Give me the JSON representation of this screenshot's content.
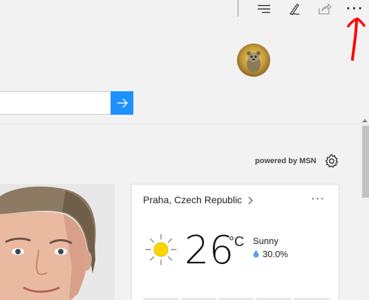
{
  "toolbar": {
    "items": [
      {
        "icon": "reading-list-icon"
      },
      {
        "icon": "pen-annotate-icon"
      },
      {
        "icon": "share-icon"
      },
      {
        "icon": "more-icon",
        "label": "···"
      }
    ]
  },
  "profile": {
    "avatar": "avatar"
  },
  "search": {
    "value": "",
    "placeholder": "",
    "button_icon": "arrow-right-icon",
    "accent": "#1e90ff"
  },
  "feed": {
    "powered_by": "powered by MSN",
    "settings_icon": "gear-icon"
  },
  "weather": {
    "location": "Praha, Czech Republic",
    "more_label": "···",
    "temperature": "26",
    "unit": "°C",
    "condition": "Sunny",
    "precipitation": "30.0%",
    "icon": "sun-icon"
  },
  "annotation": {
    "color": "#ff0000",
    "icon": "red-arrow-icon"
  }
}
